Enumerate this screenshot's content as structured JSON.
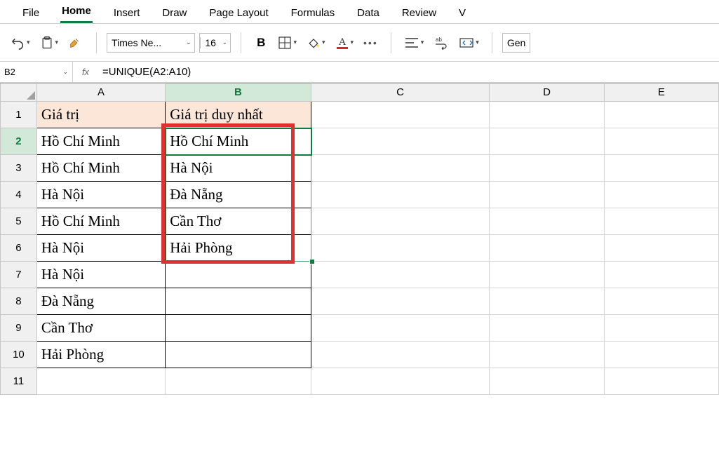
{
  "menu": {
    "tabs": [
      "File",
      "Home",
      "Insert",
      "Draw",
      "Page Layout",
      "Formulas",
      "Data",
      "Review",
      "V"
    ],
    "active": 1
  },
  "toolbar": {
    "font_name": "Times Ne...",
    "font_size": "16",
    "general_label": "Gen"
  },
  "name_box": "B2",
  "fx_label": "fx",
  "formula": "=UNIQUE(A2:A10)",
  "columns": [
    "A",
    "B",
    "C",
    "D",
    "E"
  ],
  "row_numbers": [
    "1",
    "2",
    "3",
    "4",
    "5",
    "6",
    "7",
    "8",
    "9",
    "10",
    "11"
  ],
  "active_row_index": 1,
  "headers": {
    "A": "Giá trị",
    "B": "Giá trị duy nhất"
  },
  "col_A": [
    "Hồ Chí Minh",
    "Hồ Chí Minh",
    "Hà Nội",
    "Hồ Chí Minh",
    "Hà Nội",
    "Hà Nội",
    "Đà Nẵng",
    "Cần Thơ",
    "Hải Phòng"
  ],
  "col_B": [
    "Hồ Chí Minh",
    "Hà Nội",
    "Đà Nẵng",
    "Cần Thơ",
    "Hải Phòng"
  ]
}
